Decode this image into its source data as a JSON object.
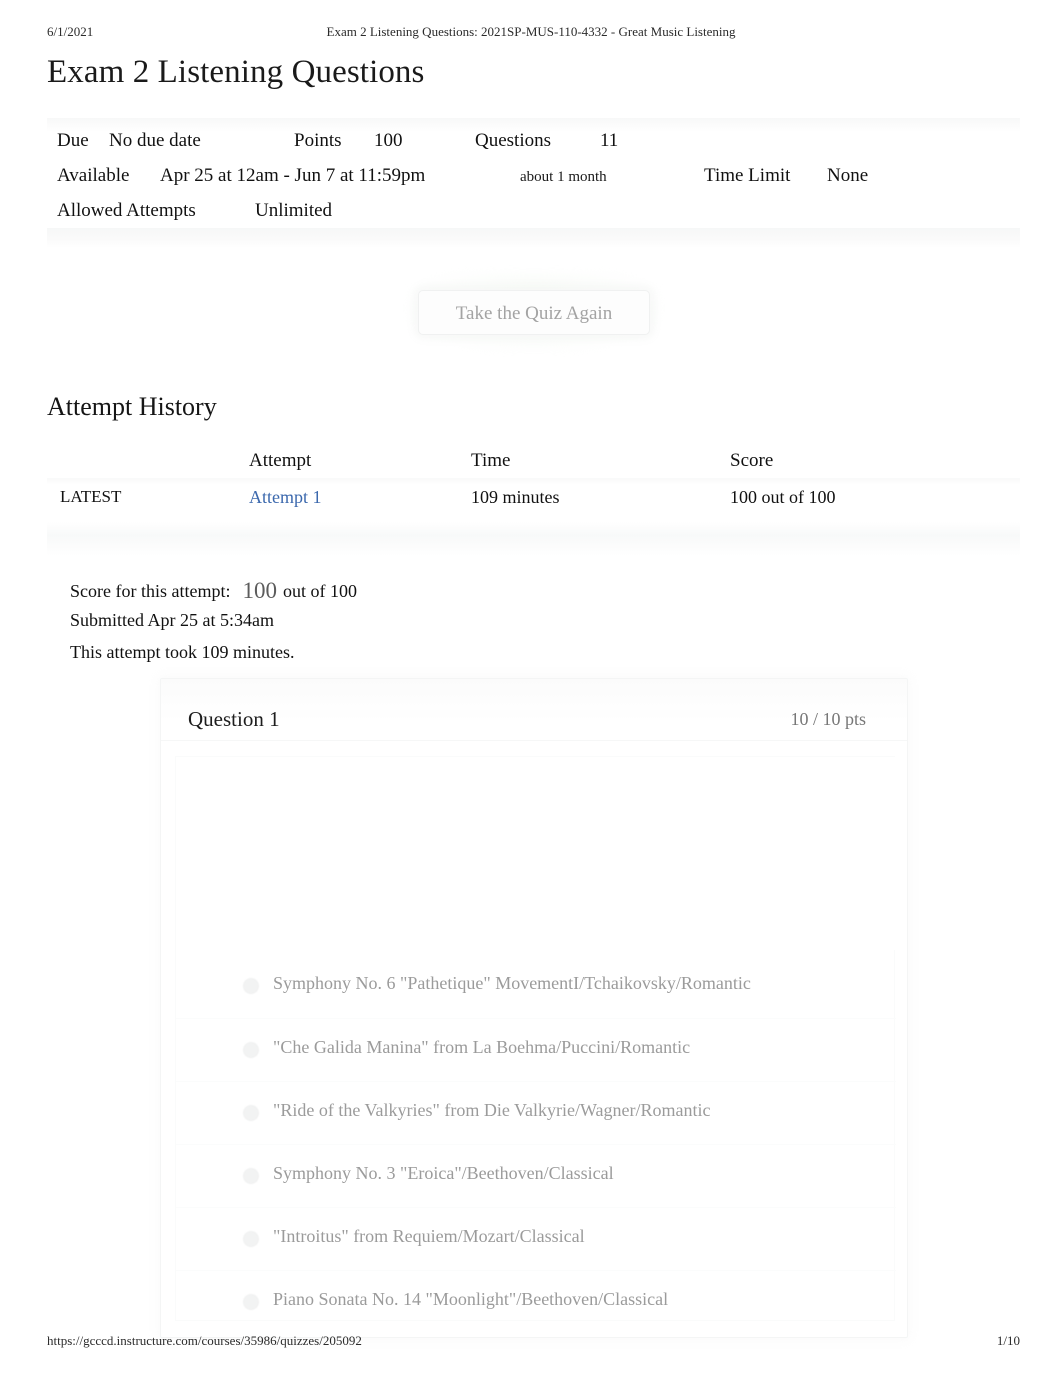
{
  "print_header": {
    "date": "6/1/2021",
    "document_title": "Exam 2 Listening Questions: 2021SP-MUS-110-4332 - Great Music Listening"
  },
  "page_title": "Exam 2 Listening Questions",
  "quiz_meta": {
    "due_label": "Due",
    "due_value": "No due date",
    "points_label": "Points",
    "points_value": "100",
    "questions_label": "Questions",
    "questions_value": "11",
    "available_label": "Available",
    "available_value": "Apr 25 at 12am - Jun 7 at 11:59pm",
    "available_duration": "about 1 month",
    "time_limit_label": "Time Limit",
    "time_limit_value": "None",
    "allowed_attempts_label": "Allowed Attempts",
    "allowed_attempts_value": "Unlimited"
  },
  "take_quiz_again_label": "Take the Quiz Again",
  "attempt_history": {
    "heading": "Attempt History",
    "columns": [
      "",
      "Attempt",
      "Time",
      "Score"
    ],
    "rows": [
      {
        "flag": "LATEST",
        "attempt": "Attempt 1",
        "time": "109 minutes",
        "score": "100 out of 100"
      }
    ]
  },
  "score_summary": {
    "score_label": "Score for this attempt:",
    "score_value": "100",
    "score_out_of": "out of 100",
    "submitted": "Submitted Apr 25 at 5:34am",
    "duration": "This attempt took 109 minutes."
  },
  "question": {
    "title": "Question 1",
    "points": "10 / 10 pts",
    "answers": [
      "Symphony No. 6 \"Pathetique\" MovementI/Tchaikovsky/Romantic",
      "\"Che Galida Manina\" from La Boehma/Puccini/Romantic",
      "\"Ride of the Valkyries\" from Die Valkyrie/Wagner/Romantic",
      "Symphony No. 3 \"Eroica\"/Beethoven/Classical",
      "\"Introitus\" from Requiem/Mozart/Classical",
      "Piano Sonata No. 14 \"Moonlight\"/Beethoven/Classical"
    ]
  },
  "print_footer": {
    "url": "https://gcccd.instructure.com/courses/35986/quizzes/205092",
    "page_number": "1/10"
  },
  "colors": {
    "link": "#3b68ad",
    "muted_text": "#9b9b9b",
    "points_text": "#777777"
  }
}
